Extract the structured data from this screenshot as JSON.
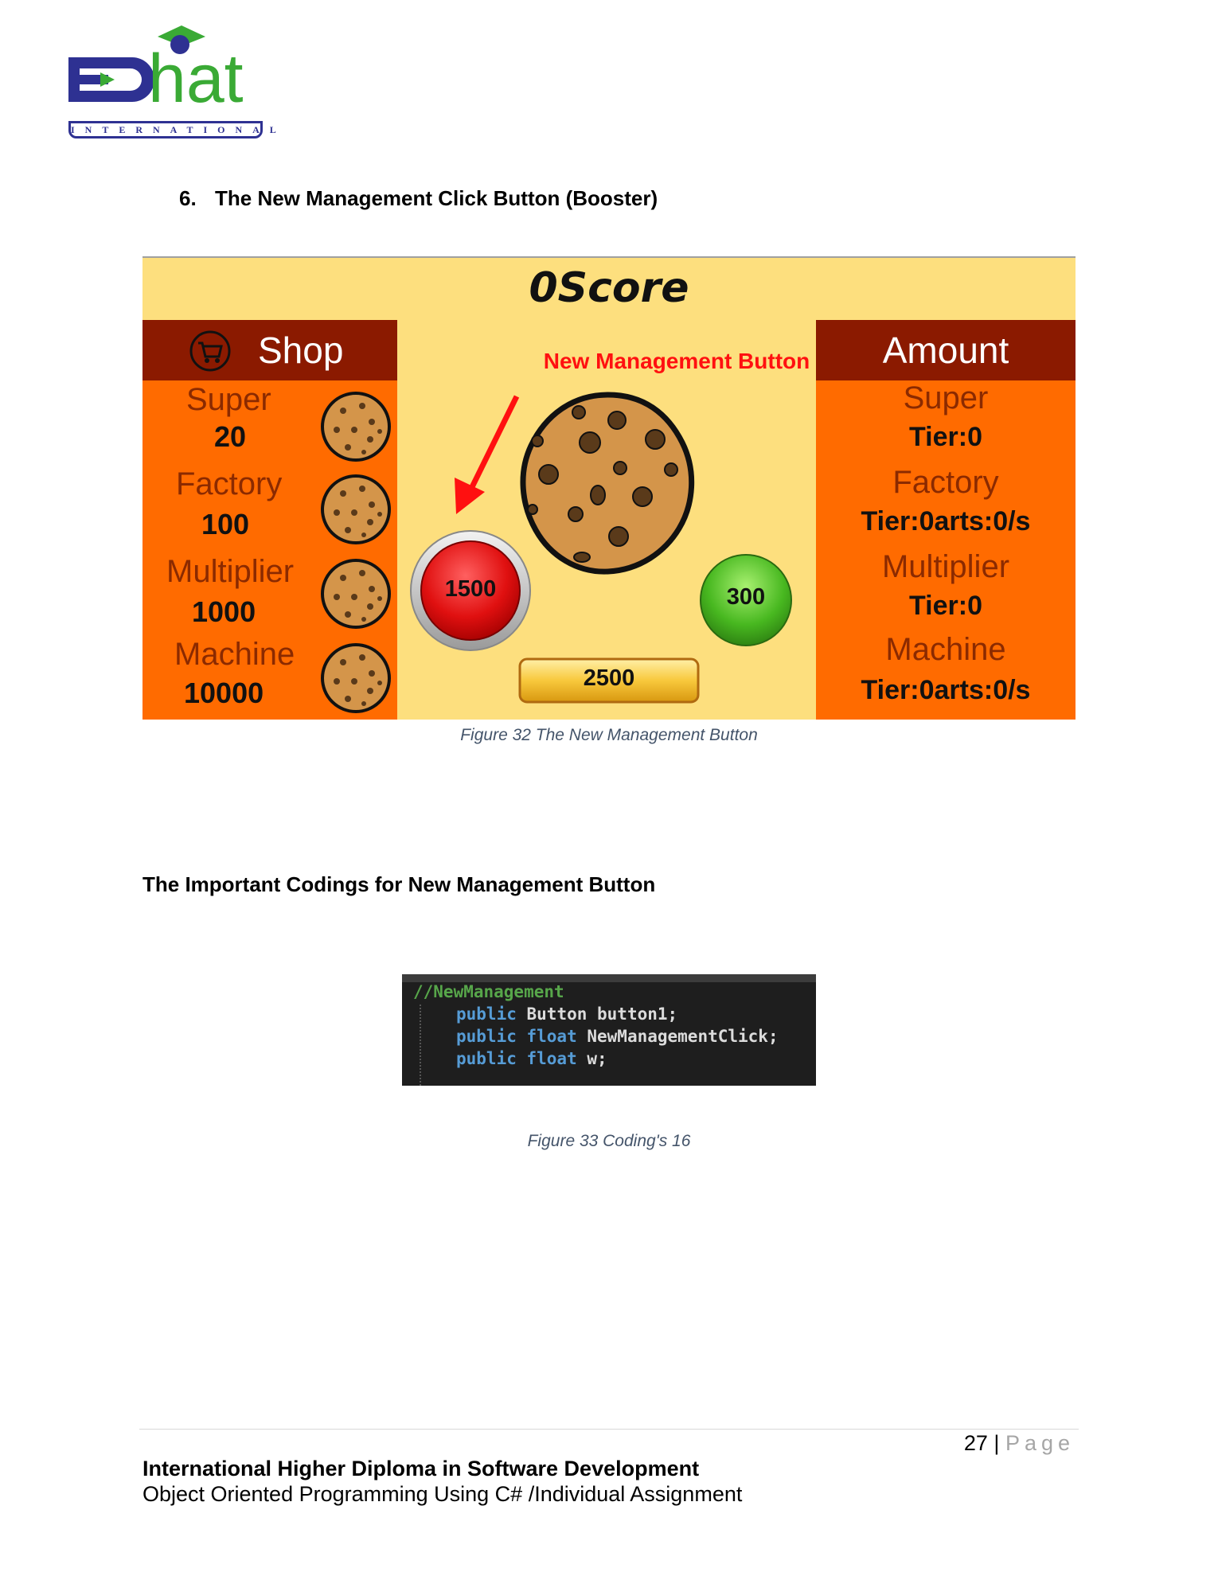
{
  "logo": {
    "text": "ED hat",
    "subtext": "INTERNATIONAL",
    "colors": {
      "navy": "#2e3192",
      "green": "#3aaa35"
    }
  },
  "section_heading": {
    "number": "6.",
    "text": "The New Management Click Button (Booster)"
  },
  "game": {
    "score": "0Score",
    "shop": {
      "title": "Shop",
      "items": [
        {
          "name": "Super",
          "price": "20"
        },
        {
          "name": "Factory",
          "price": "100"
        },
        {
          "name": "Multiplier",
          "price": "1000"
        },
        {
          "name": "Machine",
          "price": "10000"
        }
      ]
    },
    "amount": {
      "title": "Amount",
      "items": [
        {
          "name": "Super",
          "value": "Tier:0"
        },
        {
          "name": "Factory",
          "value": "Tier:0arts:0/s"
        },
        {
          "name": "Multiplier",
          "value": "Tier:0"
        },
        {
          "name": "Machine",
          "value": "Tier:0arts:0/s"
        }
      ]
    },
    "annotation": "New Management Button",
    "buttons": {
      "red": "1500",
      "green": "300",
      "gold": "2500"
    },
    "colors": {
      "background": "#fddf7e",
      "panel": "#ff6b00",
      "panel_header": "#8b1a00",
      "annotation": "#ff1010"
    }
  },
  "figure32_caption": "Figure 32 The New Management Button",
  "subheading": "The Important Codings for New Management Button",
  "code": {
    "comment": "//NewManagement",
    "lines": [
      {
        "kw": "public",
        "rest": "Button button1;"
      },
      {
        "kw": "public float",
        "rest": "NewManagementClick;"
      },
      {
        "kw": "public float",
        "rest": "w;"
      }
    ]
  },
  "figure33_caption": "Figure 33 Coding's 16",
  "footer": {
    "page_number": "27",
    "separator": " | ",
    "page_word": "Page",
    "line1": "International Higher Diploma in Software Development",
    "line2": "Object Oriented Programming Using C# /Individual Assignment"
  }
}
